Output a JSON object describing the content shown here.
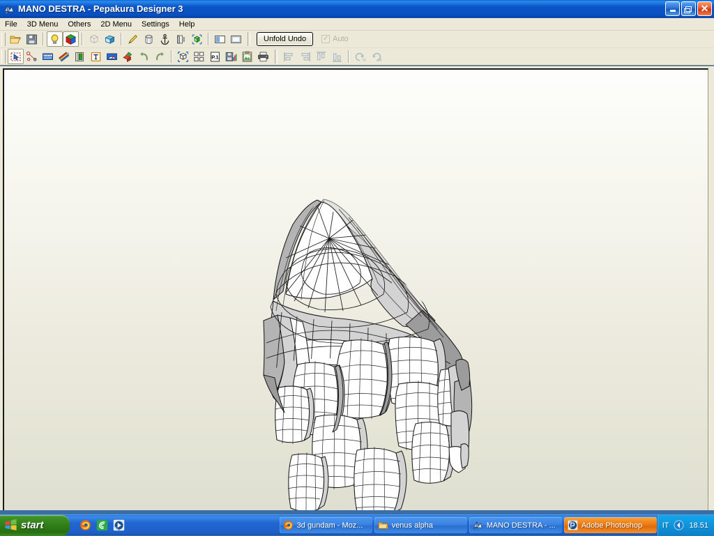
{
  "window": {
    "title_document": "MANO DESTRA",
    "title_separator": " - ",
    "title_app": "Pepakura Designer",
    "title_version": "3",
    "title_full": "MANO DESTRA - Pepakura Designer 3",
    "icon": "pepakura-app-icon",
    "controls": {
      "minimize": "Minimize",
      "maximize": "Restore",
      "close": "Close"
    }
  },
  "menubar": {
    "items": [
      {
        "label": "File"
      },
      {
        "label": "3D Menu"
      },
      {
        "label": "Others"
      },
      {
        "label": "2D Menu"
      },
      {
        "label": "Settings"
      },
      {
        "label": "Help"
      }
    ]
  },
  "toolbar_top": {
    "buttons": [
      {
        "icon": "open-folder-icon",
        "name": "open-file-button",
        "enabled": true,
        "checked": false
      },
      {
        "icon": "floppy-save-icon",
        "name": "save-file-button",
        "enabled": true,
        "checked": false
      },
      {
        "icon": "lightbulb-icon",
        "name": "toggle-lighting-button",
        "enabled": true,
        "checked": true
      },
      {
        "icon": "rgb-cube-icon",
        "name": "toggle-texture-button",
        "enabled": true,
        "checked": true
      },
      {
        "icon": "white-cube-icon",
        "name": "flat-shading-button",
        "enabled": false,
        "checked": false
      },
      {
        "icon": "blue-cube-icon",
        "name": "open-3d-model-button",
        "enabled": true,
        "checked": false
      },
      {
        "icon": "pencil-icon",
        "name": "edit-tool-button",
        "enabled": true,
        "checked": false
      },
      {
        "icon": "cylinder-icon",
        "name": "cylinder-tool-button",
        "enabled": true,
        "checked": false
      },
      {
        "icon": "anchor-icon",
        "name": "anchor-tool-button",
        "enabled": true,
        "checked": false
      },
      {
        "icon": "face-shade-icon",
        "name": "face-shading-button",
        "enabled": true,
        "checked": false
      },
      {
        "icon": "select-cube-icon",
        "name": "select-parts-button",
        "enabled": true,
        "checked": false
      },
      {
        "icon": "split-view-vertical-icon",
        "name": "split-view-button",
        "enabled": true,
        "checked": false
      },
      {
        "icon": "single-view-icon",
        "name": "single-view-button",
        "enabled": true,
        "checked": false
      }
    ],
    "unfold_undo_label": "Unfold Undo",
    "auto_label": "Auto",
    "auto_checked": true,
    "auto_enabled": false
  },
  "toolbar_bottom": {
    "buttons": [
      {
        "icon": "arrow-select-icon",
        "name": "selection-tool-button",
        "enabled": true,
        "checked": true
      },
      {
        "icon": "vertex-join-icon",
        "name": "join-edge-button",
        "enabled": true,
        "checked": false
      },
      {
        "icon": "ruler-icon",
        "name": "measure-tool-button",
        "enabled": true,
        "checked": false
      },
      {
        "icon": "flaps-icon",
        "name": "edit-flaps-button",
        "enabled": true,
        "checked": false
      },
      {
        "icon": "edge-id-icon",
        "name": "edge-id-button",
        "enabled": true,
        "checked": false
      },
      {
        "icon": "text-tool-icon",
        "name": "add-text-button",
        "enabled": true,
        "checked": false
      },
      {
        "icon": "scale-bar-icon",
        "name": "scale-tool-button",
        "enabled": true,
        "checked": false
      },
      {
        "icon": "paint-box-icon",
        "name": "paint-parts-button",
        "enabled": true,
        "checked": false
      },
      {
        "icon": "undo-arrow-icon",
        "name": "undo-button",
        "enabled": true,
        "checked": false
      },
      {
        "icon": "redo-arrow-icon",
        "name": "redo-button",
        "enabled": true,
        "checked": false
      },
      {
        "icon": "select-marquee-icon",
        "name": "marquee-select-button",
        "enabled": true,
        "checked": false
      },
      {
        "icon": "arrange-parts-icon",
        "name": "arrange-parts-button",
        "enabled": true,
        "checked": false
      },
      {
        "icon": "page-one-icon",
        "name": "page-setup-button",
        "enabled": true,
        "checked": false
      },
      {
        "icon": "save-chart-icon",
        "name": "export-data-button",
        "enabled": true,
        "checked": false
      },
      {
        "icon": "export-image-icon",
        "name": "export-image-button",
        "enabled": true,
        "checked": false
      },
      {
        "icon": "printer-icon",
        "name": "print-button",
        "enabled": true,
        "checked": false
      },
      {
        "icon": "align-left-icon",
        "name": "align-left-button",
        "enabled": false,
        "checked": false
      },
      {
        "icon": "align-right-icon",
        "name": "align-right-button",
        "enabled": false,
        "checked": false
      },
      {
        "icon": "align-top-icon",
        "name": "align-top-button",
        "enabled": false,
        "checked": false
      },
      {
        "icon": "align-bottom-icon",
        "name": "align-bottom-button",
        "enabled": false,
        "checked": false
      },
      {
        "icon": "rotate-ccw-90-icon",
        "name": "rotate-left-90-button",
        "enabled": false,
        "checked": false
      },
      {
        "icon": "rotate-cw-90-icon",
        "name": "rotate-right-90-button",
        "enabled": false,
        "checked": false
      }
    ]
  },
  "canvas": {
    "name": "3d-model-viewport",
    "description": "3D wireframe-shaded model of an armoured right hand / gauntlet (MANO DESTRA)",
    "background_top": "#fdfdfb",
    "background_bottom": "#dedfd0"
  },
  "taskbar": {
    "start_label": "start",
    "quick_launch": [
      {
        "icon": "firefox-icon",
        "name": "quicklaunch-firefox"
      },
      {
        "icon": "emule-icon",
        "name": "quicklaunch-emule"
      },
      {
        "icon": "media-icon",
        "name": "quicklaunch-media-player"
      }
    ],
    "tasks": [
      {
        "label": "3d gundam - Moz...",
        "icon": "firefox-icon",
        "active": false
      },
      {
        "label": "venus alpha",
        "icon": "folder-icon",
        "active": false
      },
      {
        "label": "MANO DESTRA - ...",
        "icon": "pepakura-icon",
        "active": false
      },
      {
        "label": "Adobe Photoshop",
        "icon": "photoshop-icon",
        "active": true
      }
    ],
    "tray": {
      "language": "IT",
      "volume_icon": "volume-icon",
      "clock": "18.51"
    }
  },
  "colors": {
    "titlebar_blue": "#0a55c8",
    "taskbar_blue": "#2166cf",
    "start_green": "#2f7d18",
    "active_task_orange": "#ef7e18",
    "chrome_beige": "#ece9d8"
  }
}
